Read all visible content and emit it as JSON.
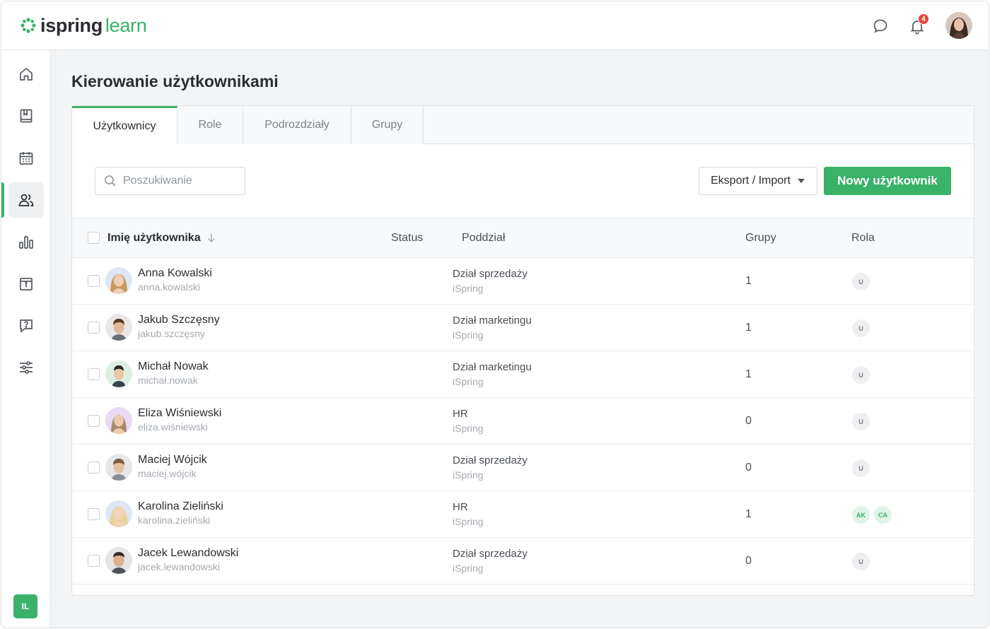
{
  "app": {
    "logo_part1": "ispring",
    "logo_part2": "learn",
    "notification_count": "4",
    "user_initials": "IL",
    "accent": "#3ab26a"
  },
  "sidebar": {
    "items": [
      {
        "icon": "home-icon"
      },
      {
        "icon": "book-icon"
      },
      {
        "icon": "calendar-icon"
      },
      {
        "icon": "users-icon",
        "active": true
      },
      {
        "icon": "bar-chart-icon"
      },
      {
        "icon": "info-calendar-icon"
      },
      {
        "icon": "question-chat-icon"
      },
      {
        "icon": "sliders-icon"
      }
    ]
  },
  "page": {
    "title": "Kierowanie użytkownikami",
    "tabs": [
      {
        "label": "Użytkownicy",
        "active": true
      },
      {
        "label": "Role"
      },
      {
        "label": "Podrozdziały"
      },
      {
        "label": "Grupy"
      }
    ],
    "search_placeholder": "Poszukiwanie",
    "export_label": "Eksport / Import",
    "new_user_label": "Nowy użytkownik"
  },
  "table": {
    "columns": {
      "name": "Imię użytkownika",
      "status": "Status",
      "department": "Poddział",
      "groups": "Grupy",
      "role": "Rola"
    },
    "rows": [
      {
        "name": "Anna Kowalski",
        "login": "anna.kowalski",
        "department": "Dział sprzedaży",
        "org": "iSpring",
        "groups": "1",
        "roles": [
          "U"
        ]
      },
      {
        "name": "Jakub Szczęsny",
        "login": "jakub.szczęsny",
        "department": "Dział marketingu",
        "org": "iSpring",
        "groups": "1",
        "roles": [
          "U"
        ]
      },
      {
        "name": "Michał Nowak",
        "login": "michał.nowak",
        "department": "Dział marketingu",
        "org": "iSpring",
        "groups": "1",
        "roles": [
          "U"
        ]
      },
      {
        "name": "Eliza Wiśniewski",
        "login": "eliza.wiśniewski",
        "department": "HR",
        "org": "iSpring",
        "groups": "0",
        "roles": [
          "U"
        ]
      },
      {
        "name": "Maciej Wójcik",
        "login": "maciej.wójcik",
        "department": "Dział sprzedaży",
        "org": "iSpring",
        "groups": "0",
        "roles": [
          "U"
        ]
      },
      {
        "name": "Karolina Zieliński",
        "login": "karolina.zieliński",
        "department": "HR",
        "org": "iSpring",
        "groups": "1",
        "roles": [
          "AK",
          "CA"
        ]
      },
      {
        "name": "Jacek Lewandowski",
        "login": "jacek.lewandowski",
        "department": "Dział sprzedaży",
        "org": "iSpring",
        "groups": "0",
        "roles": [
          "U"
        ]
      }
    ]
  }
}
